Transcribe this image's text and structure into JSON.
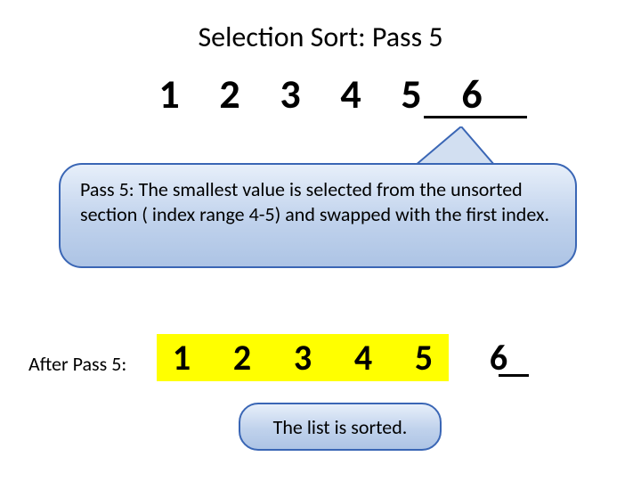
{
  "title": "Selection Sort: Pass 5",
  "array_before": {
    "n0": "1",
    "n1": "2",
    "n2": "3",
    "n3": "4",
    "n4": "5",
    "n5": "6"
  },
  "callout_text": "Pass 5: The smallest value is selected from the unsorted section ( index range 4-5) and swapped with the first index.",
  "after_label": "After Pass 5:",
  "array_after": {
    "n0": "1",
    "n1": "2",
    "n2": "3",
    "n3": "4",
    "n4": "5",
    "n5": "6"
  },
  "sorted_text": "The list is sorted."
}
